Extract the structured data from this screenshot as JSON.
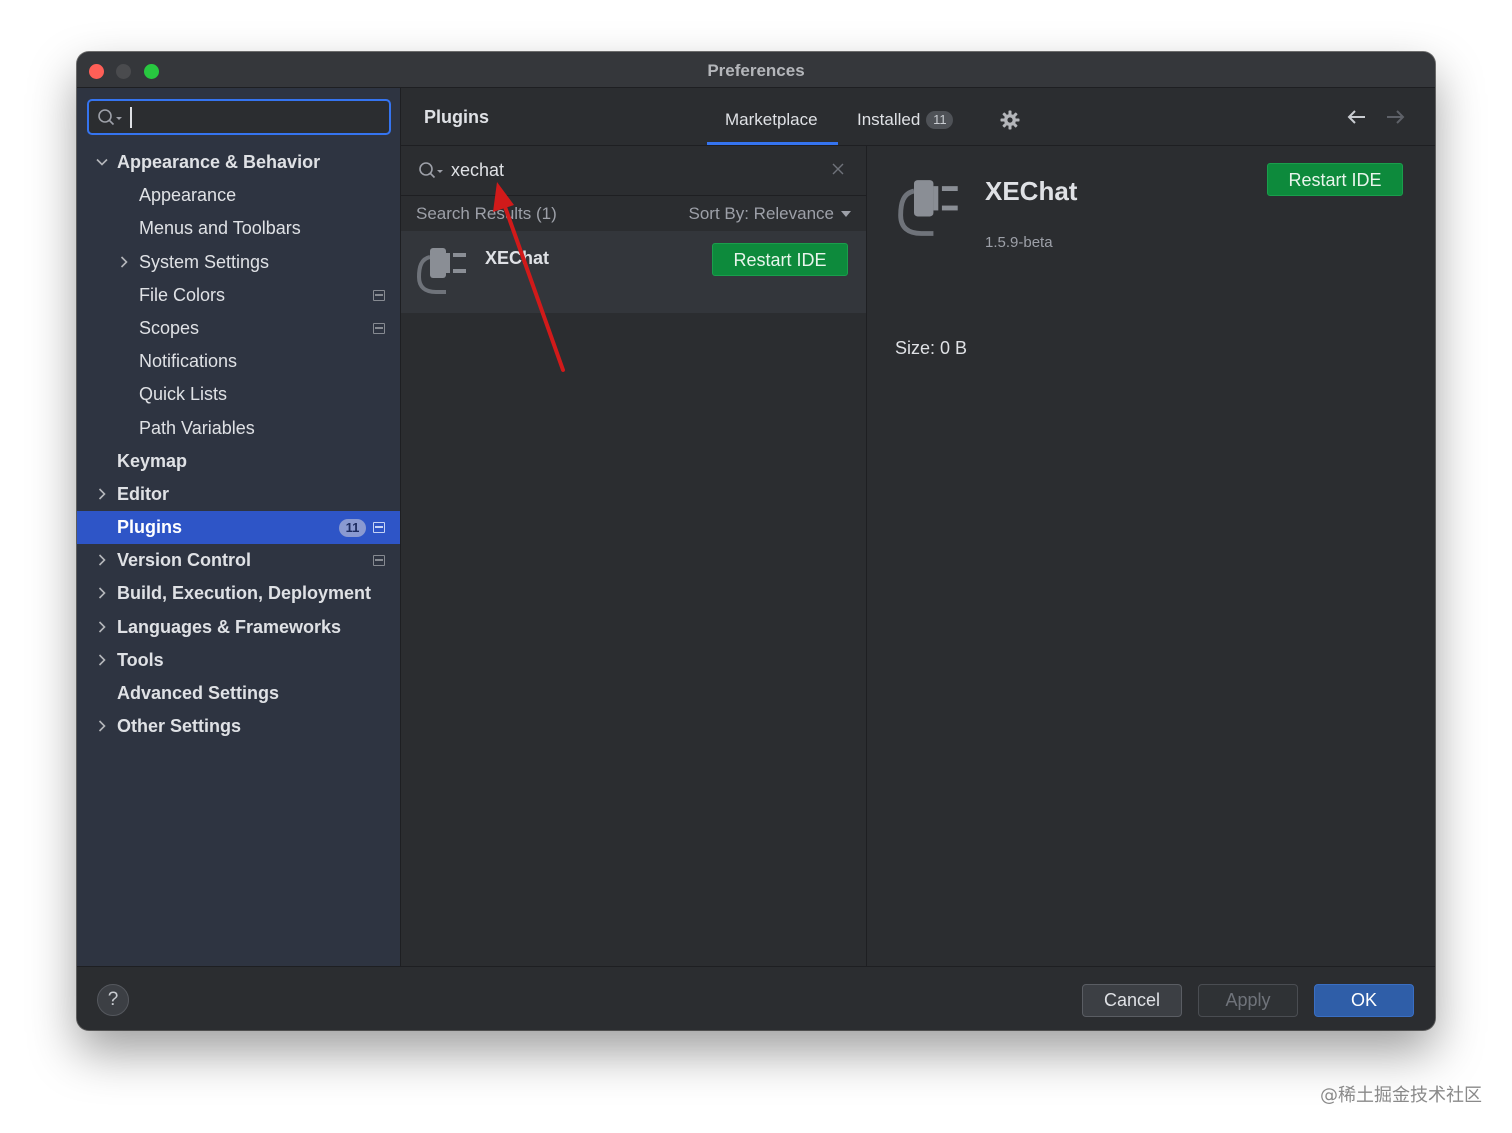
{
  "window": {
    "title": "Preferences"
  },
  "sidebar": {
    "search": {
      "value": "",
      "placeholder": ""
    },
    "items": [
      {
        "label": "Appearance & Behavior",
        "level": 0,
        "bold": true,
        "expandable": true,
        "expanded": true
      },
      {
        "label": "Appearance",
        "level": 1
      },
      {
        "label": "Menus and Toolbars",
        "level": 1
      },
      {
        "label": "System Settings",
        "level": 1,
        "expandable": true
      },
      {
        "label": "File Colors",
        "level": 1,
        "project": true
      },
      {
        "label": "Scopes",
        "level": 1,
        "project": true
      },
      {
        "label": "Notifications",
        "level": 1
      },
      {
        "label": "Quick Lists",
        "level": 1
      },
      {
        "label": "Path Variables",
        "level": 1
      },
      {
        "label": "Keymap",
        "level": 0,
        "bold": true
      },
      {
        "label": "Editor",
        "level": 0,
        "bold": true,
        "expandable": true
      },
      {
        "label": "Plugins",
        "level": 0,
        "bold": true,
        "selected": true,
        "badge": "11",
        "project": true
      },
      {
        "label": "Version Control",
        "level": 0,
        "bold": true,
        "expandable": true,
        "project": true
      },
      {
        "label": "Build, Execution, Deployment",
        "level": 0,
        "bold": true,
        "expandable": true
      },
      {
        "label": "Languages & Frameworks",
        "level": 0,
        "bold": true,
        "expandable": true
      },
      {
        "label": "Tools",
        "level": 0,
        "bold": true,
        "expandable": true
      },
      {
        "label": "Advanced Settings",
        "level": 0,
        "bold": true
      },
      {
        "label": "Other Settings",
        "level": 0,
        "bold": true,
        "expandable": true
      }
    ]
  },
  "plugins": {
    "title": "Plugins",
    "tabs": {
      "marketplace": "Marketplace",
      "installed": "Installed",
      "installed_count": "11"
    },
    "search": {
      "query": "xechat"
    },
    "results": {
      "count_label": "Search Results (1)",
      "sort_label": "Sort By: Relevance"
    },
    "result": {
      "name": "XEChat",
      "action": "Restart IDE"
    },
    "detail": {
      "name": "XEChat",
      "version": "1.5.9-beta",
      "action": "Restart IDE",
      "size": "Size: 0 B"
    }
  },
  "footer": {
    "help": "?",
    "cancel": "Cancel",
    "apply": "Apply",
    "ok": "OK"
  },
  "watermark": "@稀土掘金技术社区",
  "colors": {
    "accent": "#3574f0",
    "selection": "#2e55c7",
    "green_button": "#0d8a3c",
    "annotation_arrow": "#d11a1a",
    "icons": [
      "search-icon",
      "chevron-down-icon",
      "chevron-right-icon",
      "gear-icon",
      "arrow-left-icon",
      "arrow-right-icon",
      "plug-icon",
      "close-icon"
    ]
  }
}
